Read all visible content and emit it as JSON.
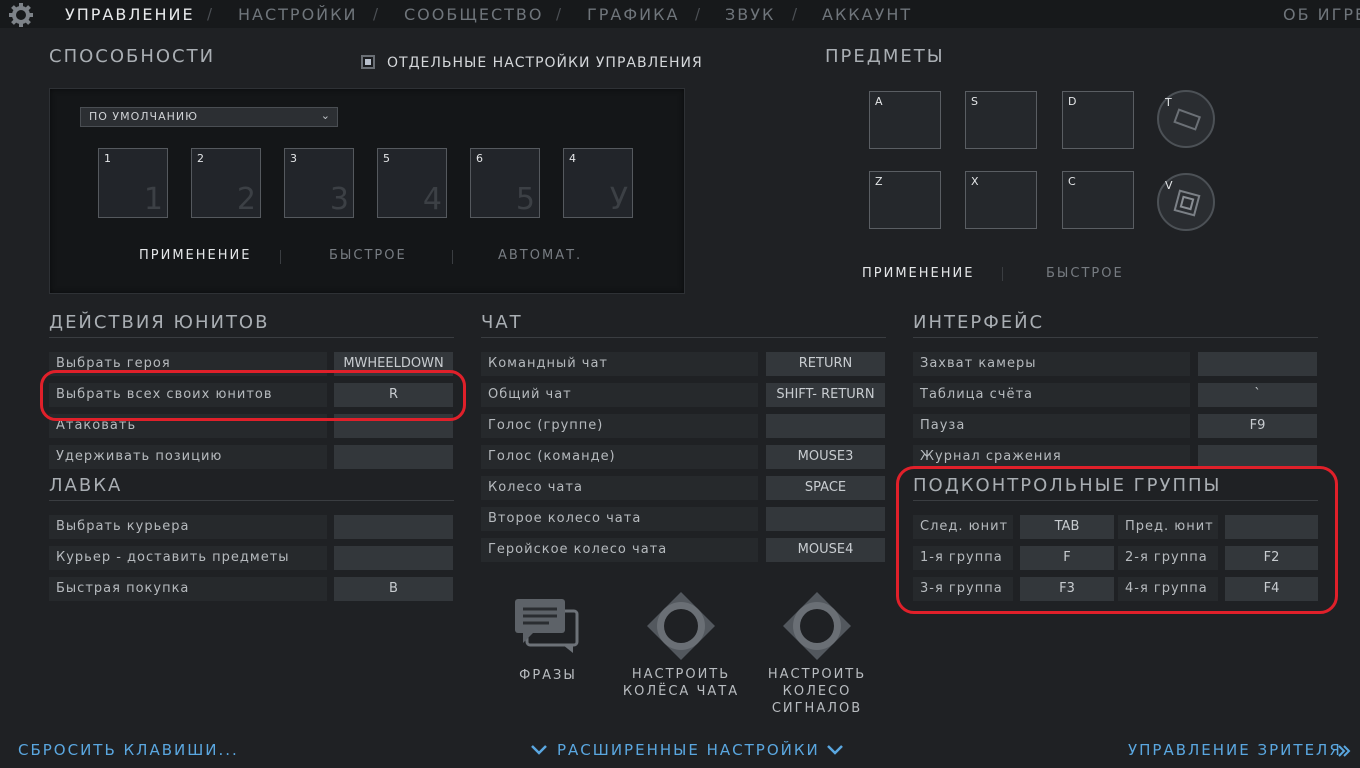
{
  "nav": {
    "items": [
      "УПРАВЛЕНИЕ",
      "НАСТРОЙКИ",
      "СООБЩЕСТВО",
      "ГРАФИКА",
      "ЗВУК",
      "АККАУНТ"
    ],
    "about": "ОБ ИГРЕ",
    "separator": "/"
  },
  "abilities": {
    "title": "СПОСОБНОСТИ",
    "separate_controls_label": "ОТДЕЛЬНЫЕ НАСТРОЙКИ УПРАВЛЕНИЯ",
    "preset": "ПО УМОЛЧАНИЮ",
    "slots": [
      {
        "key": "1",
        "big": "1"
      },
      {
        "key": "2",
        "big": "2"
      },
      {
        "key": "3",
        "big": "3"
      },
      {
        "key": "5",
        "big": "4"
      },
      {
        "key": "6",
        "big": "5"
      },
      {
        "key": "4",
        "big": "У"
      }
    ],
    "modes": [
      "ПРИМЕНЕНИЕ",
      "БЫСТРОЕ",
      "АВТОМАТ."
    ]
  },
  "items": {
    "title": "ПРЕДМЕТЫ",
    "slots_top": [
      "A",
      "S",
      "D"
    ],
    "slots_bottom": [
      "Z",
      "X",
      "C"
    ],
    "round_top": "T",
    "round_bottom": "V",
    "modes": [
      "ПРИМЕНЕНИЕ",
      "БЫСТРОЕ"
    ]
  },
  "unit_actions": {
    "title": "ДЕЙСТВИЯ ЮНИТОВ",
    "rows": [
      {
        "label": "Выбрать героя",
        "key": "MWHEELDOWN"
      },
      {
        "label": "Выбрать всех своих юнитов",
        "key": "R"
      },
      {
        "label": "Атаковать",
        "key": ""
      },
      {
        "label": "Удерживать позицию",
        "key": ""
      }
    ]
  },
  "shop": {
    "title": "ЛАВКА",
    "rows": [
      {
        "label": "Выбрать курьера",
        "key": ""
      },
      {
        "label": "Курьер - доставить предметы",
        "key": ""
      },
      {
        "label": "Быстрая покупка",
        "key": "B"
      }
    ]
  },
  "chat": {
    "title": "ЧАТ",
    "rows": [
      {
        "label": "Командный чат",
        "key": "RETURN"
      },
      {
        "label": "Общий чат",
        "key": "SHIFT- RETURN"
      },
      {
        "label": "Голос (группе)",
        "key": ""
      },
      {
        "label": "Голос (команде)",
        "key": "MOUSE3"
      },
      {
        "label": "Колесо чата",
        "key": "SPACE"
      },
      {
        "label": "Второе колесо чата",
        "key": ""
      },
      {
        "label": "Геройское колесо чата",
        "key": "MOUSE4"
      }
    ],
    "buttons": [
      {
        "lines": [
          "ФРАЗЫ"
        ]
      },
      {
        "lines": [
          "НАСТРОИТЬ",
          "КОЛЁСА ЧАТА"
        ]
      },
      {
        "lines": [
          "НАСТРОИТЬ",
          "КОЛЕСО",
          "СИГНАЛОВ"
        ]
      }
    ]
  },
  "interface": {
    "title": "ИНТЕРФЕЙС",
    "rows": [
      {
        "label": "Захват камеры",
        "key": ""
      },
      {
        "label": "Таблица счёта",
        "key": "`"
      },
      {
        "label": "Пауза",
        "key": "F9"
      },
      {
        "label": "Журнал сражения",
        "key": ""
      }
    ]
  },
  "control_groups": {
    "title": "ПОДКОНТРОЛЬНЫЕ ГРУППЫ",
    "rows": [
      [
        {
          "label": "След. юнит",
          "key": "TAB"
        },
        {
          "label": "Пред. юнит",
          "key": ""
        }
      ],
      [
        {
          "label": "1-я группа",
          "key": "F"
        },
        {
          "label": "2-я группа",
          "key": "F2"
        }
      ],
      [
        {
          "label": "3-я группа",
          "key": "F3"
        },
        {
          "label": "4-я группа",
          "key": "F4"
        }
      ]
    ]
  },
  "footer": {
    "reset": "СБРОСИТЬ КЛАВИШИ...",
    "advanced": "РАСШИРЕННЫЕ НАСТРОЙКИ",
    "spectator": "УПРАВЛЕНИЕ ЗРИТЕЛЯ"
  },
  "colors": {
    "highlight": "#e0202a",
    "link": "#5aa7e0"
  }
}
